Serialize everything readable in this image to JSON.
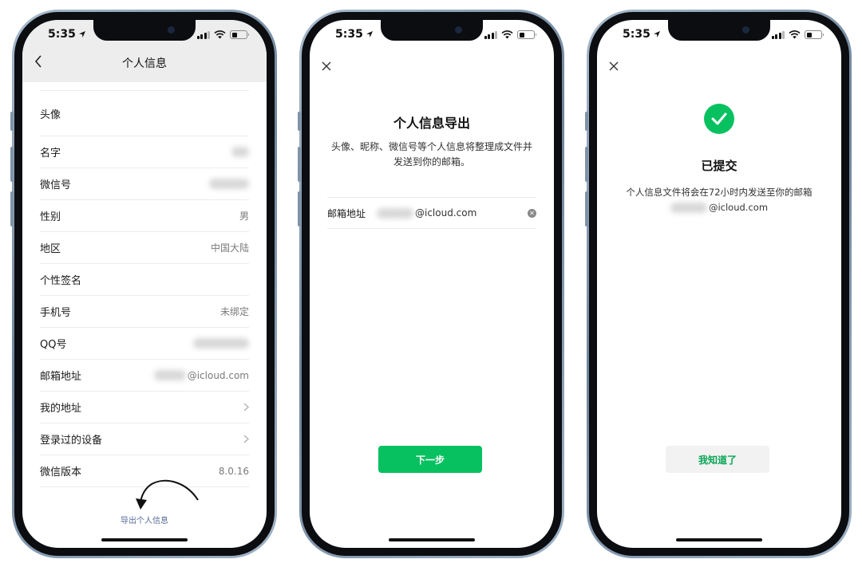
{
  "status_bar": {
    "time": "5:35"
  },
  "screen1": {
    "title": "个人信息",
    "rows": [
      {
        "label": "头像",
        "value": ""
      },
      {
        "label": "名字",
        "value": ""
      },
      {
        "label": "微信号",
        "value": ""
      },
      {
        "label": "性别",
        "value": "男"
      },
      {
        "label": "地区",
        "value": "中国大陆"
      },
      {
        "label": "个性签名",
        "value": ""
      },
      {
        "label": "手机号",
        "value": "未绑定"
      },
      {
        "label": "QQ号",
        "value": ""
      },
      {
        "label": "邮箱地址",
        "value": "@icloud.com"
      },
      {
        "label": "我的地址",
        "value": ""
      },
      {
        "label": "登录过的设备",
        "value": ""
      },
      {
        "label": "微信版本",
        "value": "8.0.16"
      }
    ],
    "export_link": "导出个人信息"
  },
  "screen2": {
    "title": "个人信息导出",
    "desc_line1": "头像、昵称、微信号等个人信息将整理成文件并",
    "desc_line2": "发送到你的邮箱。",
    "email_label": "邮箱地址",
    "email_value": "@icloud.com",
    "next_button": "下一步"
  },
  "screen3": {
    "title": "已提交",
    "desc_line1": "个人信息文件将会在72小时内发送至你的邮箱",
    "email_value": "@icloud.com",
    "ok_button": "我知道了"
  },
  "colors": {
    "accent_green": "#07c160",
    "link_blue": "#576b95"
  }
}
